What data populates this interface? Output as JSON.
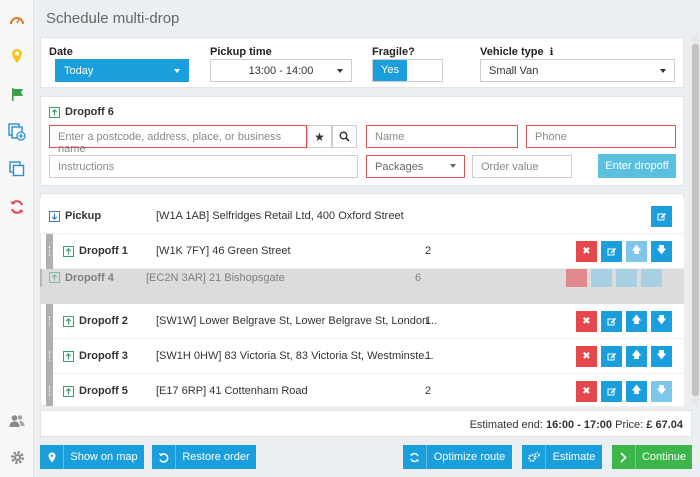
{
  "sidebar": {
    "icons": [
      "speedometer-icon",
      "location-pin-icon",
      "flag-icon",
      "copy-add-icon",
      "copy-icon",
      "sync-icon",
      "users-icon",
      "gear-icon"
    ]
  },
  "page": {
    "title": "Schedule multi-drop"
  },
  "options": {
    "date_label": "Date",
    "date_value": "Today",
    "pickup_label": "Pickup time",
    "pickup_value": "13:00 - 14:00",
    "fragile_label": "Fragile?",
    "fragile_value": "Yes",
    "vehicle_label": "Vehicle type",
    "vehicle_info": "ℹ",
    "vehicle_value": "Small Van"
  },
  "dropoff_form": {
    "title": "Dropoff 6",
    "address_placeholder": "Enter a postcode, address, place, or business name",
    "name_placeholder": "Name",
    "phone_placeholder": "Phone",
    "instructions_placeholder": "Instructions",
    "packages_placeholder": "Packages",
    "order_value_placeholder": "Order value",
    "enter_label": "Enter dropoff"
  },
  "pickup": {
    "label": "Pickup",
    "address": "[W1A 1AB] Selfridges Retail Ltd, 400 Oxford Street"
  },
  "dropoffs": [
    {
      "label": "Dropoff 1",
      "address": "[W1K 7FY] 46 Green Street",
      "count": "2"
    },
    {
      "label": "Dropoff 2",
      "address": "[SW1W] Lower Belgrave St, Lower Belgrave St, London...",
      "count": "1"
    },
    {
      "label": "Dropoff 3",
      "address": "[SW1H 0HW] 83 Victoria St, 83 Victoria St, Westminste...",
      "count": "1"
    },
    {
      "label": "Dropoff 5",
      "address": "[E17 6RP] 41 Cottenham Road",
      "count": "2"
    }
  ],
  "dragging": {
    "label": "Dropoff 4",
    "address": "[EC2N 3AR] 21 Bishopsgate",
    "count": "6"
  },
  "summary": {
    "estimated_label": "Estimated end:",
    "estimated_value": "16:00 - 17:00",
    "price_label": "Price:",
    "price_value": "£ 67.04"
  },
  "actions": {
    "show_map": "Show on map",
    "restore": "Restore order",
    "optimize": "Optimize route",
    "estimate": "Estimate",
    "continue": "Continue"
  },
  "colors": {
    "blue": "#1a9fdc",
    "green": "#3cb54a",
    "red": "#e4474c"
  }
}
